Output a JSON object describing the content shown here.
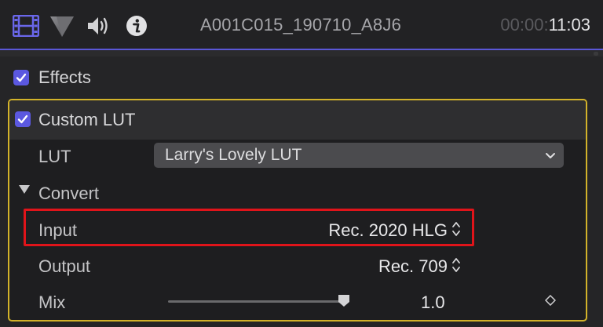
{
  "toolbar": {
    "icons": [
      "film-icon",
      "color-shape-icon",
      "speaker-icon",
      "info-icon"
    ],
    "clip_name": "A001C015_190710_A8J6",
    "timecode_dim": "00:00:",
    "timecode_bright": "11:03"
  },
  "inspector": {
    "effects_label": "Effects",
    "effects_enabled": true,
    "effect": {
      "title": "Custom LUT",
      "enabled": true,
      "lut_label": "LUT",
      "lut_value": "Larry's Lovely LUT",
      "convert_label": "Convert",
      "input_label": "Input",
      "input_value": "Rec. 2020 HLG",
      "output_label": "Output",
      "output_value": "Rec. 709",
      "mix_label": "Mix",
      "mix_value": "1.0",
      "mix_level": 1.0
    }
  },
  "colors": {
    "accent": "#5b58e0",
    "selection_border": "#d3b32a",
    "highlight_box": "#e0141a"
  }
}
